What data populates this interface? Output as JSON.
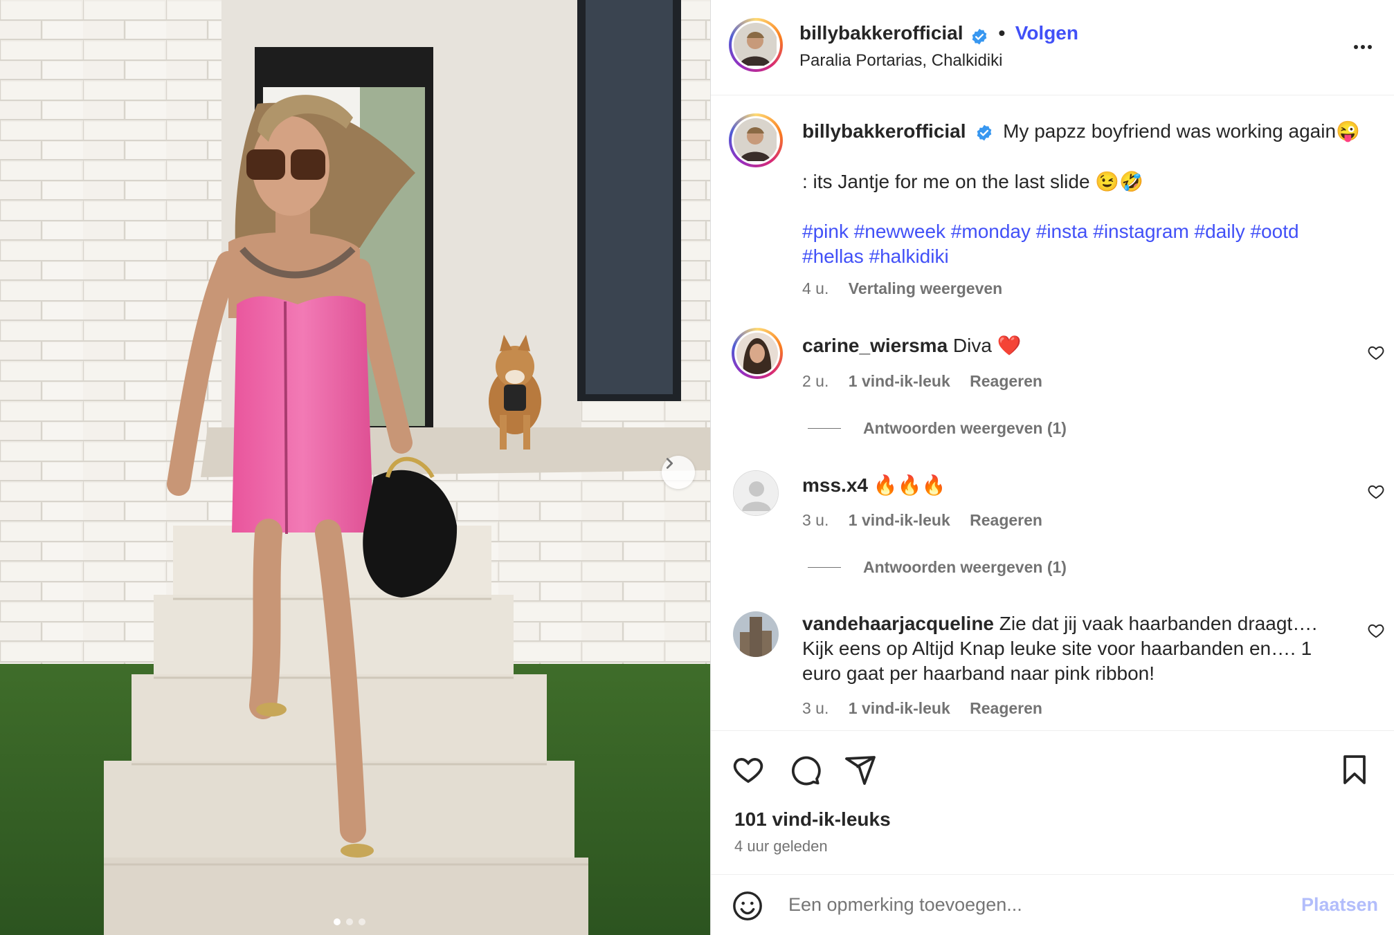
{
  "post": {
    "username": "billybakkerofficial",
    "follow_label": "Volgen",
    "separator": "•",
    "location": "Paralia Portarias, Chalkidiki",
    "more_label": "...",
    "caption": {
      "line1": "My papzz boyfriend was working again😜",
      "line2": ": its Jantje for me on the last slide 😉🤣",
      "hashtags_line1": "#pink #newweek #monday #insta #instagram #daily #ootd",
      "hashtags_line2": "#hellas #halkidiki",
      "time": "4 u.",
      "translate_label": "Vertaling weergeven"
    },
    "likes": "101 vind-ik-leuks",
    "posted_ago": "4 uur geleden",
    "carousel": {
      "slide_count": 3,
      "active_slide": 1
    }
  },
  "comments": [
    {
      "username": "carine_wiersma",
      "text": "Diva ❤️",
      "time": "2 u.",
      "likes": "1 vind-ik-leuk",
      "reply_label": "Reageren",
      "view_replies": "Antwoorden weergeven (1)"
    },
    {
      "username": "mss.x4",
      "text": "🔥🔥🔥",
      "time": "3 u.",
      "likes": "1 vind-ik-leuk",
      "reply_label": "Reageren",
      "view_replies": "Antwoorden weergeven (1)"
    },
    {
      "username": "vandehaarjacqueline",
      "text_line1": "Zie dat jij vaak haarbanden draagt….",
      "text_line2": "Kijk eens op Altijd Knap leuke site voor haarbanden en…. 1",
      "text_line3": "euro gaat per haarband naar pink ribbon!",
      "time": "3 u.",
      "likes": "1 vind-ik-leuk",
      "reply_label": "Reageren"
    }
  ],
  "composer": {
    "placeholder": "Een opmerking toevoegen...",
    "post_label": "Plaatsen"
  },
  "colors": {
    "link_blue": "#4150f7",
    "verified_blue": "#3897f0",
    "muted": "#737373",
    "dress_pink": "#f06bab"
  },
  "icons": [
    "chevron-right-icon",
    "verified-badge-icon",
    "more-icon",
    "heart-icon",
    "comment-icon",
    "share-icon",
    "bookmark-icon",
    "emoji-icon"
  ]
}
